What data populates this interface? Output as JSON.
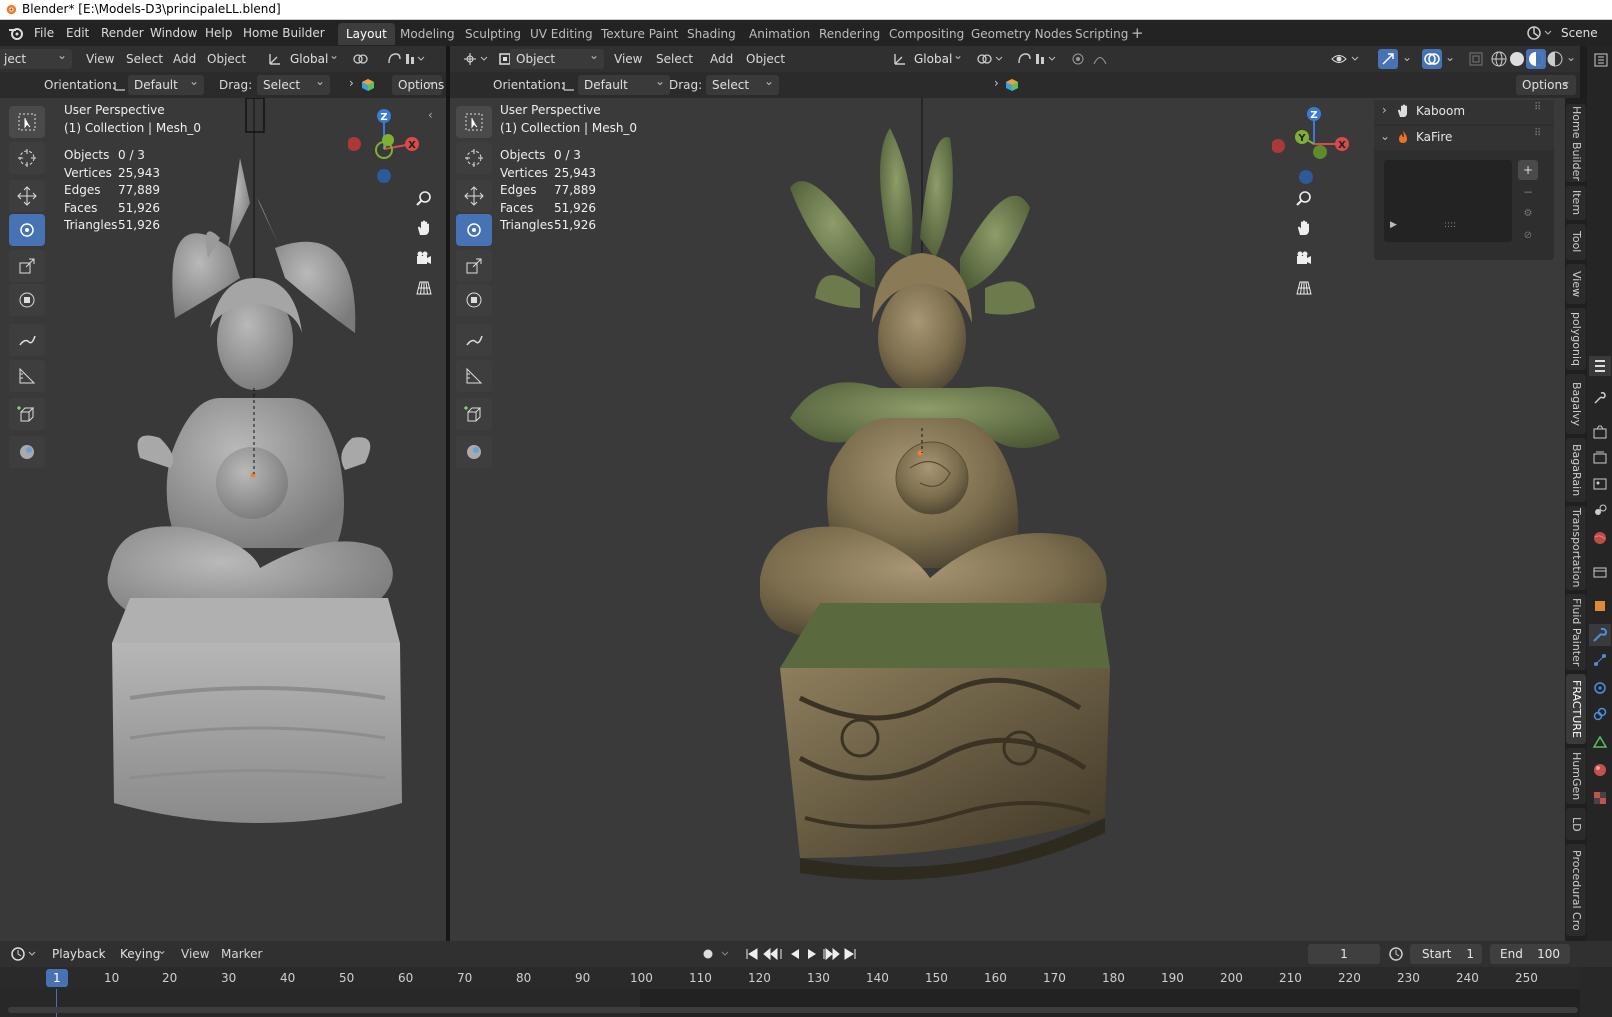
{
  "window": {
    "title": "Blender* [E:\\Models-D3\\principaleLL.blend]"
  },
  "menu": [
    "File",
    "Edit",
    "Render",
    "Window",
    "Help",
    "Home Builder"
  ],
  "workspaces": [
    "Layout",
    "Modeling",
    "Sculpting",
    "UV Editing",
    "Texture Paint",
    "Shading",
    "Animation",
    "Rendering",
    "Compositing",
    "Geometry Nodes",
    "Scripting"
  ],
  "scene_label": "Scene",
  "left_view": {
    "mode": "Object Mode",
    "mode_partial": "ject Mode",
    "menus": [
      "View",
      "Select",
      "Add",
      "Object"
    ],
    "transform": "Global",
    "orientation_label": "Orientation:",
    "orientation": "Default",
    "drag_label": "Drag:",
    "drag": "Select Box",
    "options": "Options",
    "title": "User Perspective",
    "collection": "(1) Collection | Mesh_0",
    "stats": [
      {
        "label": "Objects",
        "value": "0 / 3"
      },
      {
        "label": "Vertices",
        "value": "25,943"
      },
      {
        "label": "Edges",
        "value": "77,889"
      },
      {
        "label": "Faces",
        "value": "51,926"
      },
      {
        "label": "Triangles",
        "value": "51,926"
      }
    ]
  },
  "right_view": {
    "mode": "Object Mode",
    "menus": [
      "View",
      "Select",
      "Add",
      "Object"
    ],
    "transform": "Global",
    "orientation_label": "Orientation:",
    "orientation": "Default",
    "drag_label": "Drag:",
    "drag": "Select Box",
    "options": "Options",
    "title": "User Perspective",
    "collection": "(1) Collection | Mesh_0",
    "stats": [
      {
        "label": "Objects",
        "value": "0 / 3"
      },
      {
        "label": "Vertices",
        "value": "25,943"
      },
      {
        "label": "Edges",
        "value": "77,889"
      },
      {
        "label": "Faces",
        "value": "51,926"
      },
      {
        "label": "Triangles",
        "value": "51,926"
      }
    ]
  },
  "gizmo_axes": {
    "x": "X",
    "y": "Y",
    "z": "Z"
  },
  "side_panel": {
    "items": [
      {
        "label": "Kaboom",
        "icon": "hand-icon"
      },
      {
        "label": "KaFire",
        "icon": "fire-icon"
      }
    ]
  },
  "side_tabs": [
    "Home Builder",
    "Item",
    "Tool",
    "View",
    "polygoniq",
    "Bagalvy",
    "BagaRain",
    "Transportation",
    "Fluid Painter",
    "FRACTURE",
    "HumGen",
    "LD",
    "Procedural Cro"
  ],
  "timeline": {
    "menus": [
      "Playback",
      "Keying",
      "View",
      "Marker"
    ],
    "current_frame": "1",
    "start_label": "Start",
    "start": "1",
    "end_label": "End",
    "end": "100",
    "ticks": [
      "1",
      "10",
      "20",
      "30",
      "40",
      "50",
      "60",
      "70",
      "80",
      "90",
      "100",
      "110",
      "120",
      "130",
      "140",
      "150",
      "160",
      "170",
      "180",
      "190",
      "200",
      "210",
      "220",
      "230",
      "240",
      "250"
    ]
  },
  "colors": {
    "accent": "#4772b3",
    "axis_x": "#d94a4a",
    "axis_y": "#7fb035",
    "axis_z": "#3b7bd6",
    "viewport_bg": "#393939"
  }
}
